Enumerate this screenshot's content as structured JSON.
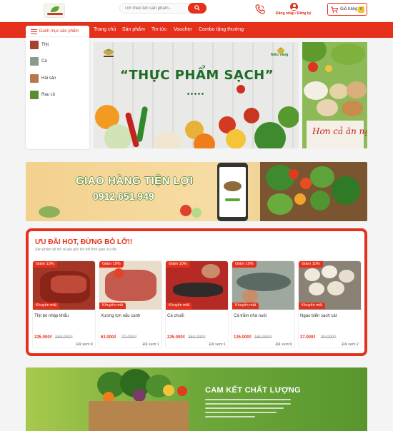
{
  "colors": {
    "brand_red": "#e5301c",
    "brand_green": "#1e6b26",
    "badge_yellow": "#f5c331"
  },
  "header": {
    "search_placeholder": "Tìm theo tên sản phẩm...",
    "login_label": "Đăng nhập / Đăng ký",
    "cart_label": "Giỏ hàng",
    "cart_count": "0"
  },
  "nav": {
    "items": [
      "Trang chủ",
      "Sản phẩm",
      "Tin tức",
      "Voucher",
      "Combo tặng thưởng"
    ]
  },
  "sidebar": {
    "title": "Danh mục sản phẩm",
    "items": [
      {
        "label": "Thịt",
        "color": "#a8402f"
      },
      {
        "label": "Cá",
        "color": "#8c9a8a"
      },
      {
        "label": "Hải sản",
        "color": "#b8774a"
      },
      {
        "label": "Rau củ",
        "color": "#5b8b33"
      }
    ]
  },
  "hero": {
    "title": "“THỰC PHẨM SẠCH”",
    "brand": "Niêu Vàng"
  },
  "side_banner": {
    "book_title": "Hơn cả ăn ngon"
  },
  "delivery": {
    "title": "GIAO HÀNG TIỆN LỢI",
    "phone": "0912.651.949"
  },
  "deals": {
    "title": "ƯU ĐÃI HOT, ĐỪNG BỎ LỠ!!",
    "subtitle": "Sản phẩm sẽ trở về giá gốc khi hết thời gian ưu đãi",
    "products": [
      {
        "name": "Thịt bò nhập khẩu",
        "discount": "Giảm 10%",
        "promo": "Khuyến mãi",
        "price": "225.000₫",
        "old_price": "250.000₫",
        "sold": "Đã xem:0",
        "img": "#a33626"
      },
      {
        "name": "Xương lợn nấu canh",
        "discount": "Giảm 10%",
        "promo": "Khuyến mãi",
        "price": "63.000₫",
        "old_price": "70.000₫",
        "sold": "Đã xem:1",
        "img": "#c45a4d"
      },
      {
        "name": "Cá chuối",
        "discount": "Giảm 10%",
        "promo": "Khuyến mãi",
        "price": "225.000₫",
        "old_price": "250.000₫",
        "sold": "Đã xem:1",
        "img": "#b52a24"
      },
      {
        "name": "Cá trắm nhà nuôi",
        "discount": "Giảm 10%",
        "promo": "Khuyến mãi",
        "price": "135.000₫",
        "old_price": "150.000₫",
        "sold": "Đã xem:0",
        "img": "#6e8079"
      },
      {
        "name": "Ngao biển sạch cát",
        "discount": "Giảm 10%",
        "promo": "Khuyến mãi",
        "price": "27.000₫",
        "old_price": "30.000₫",
        "sold": "Đã xem:2",
        "img": "#8a8375"
      }
    ]
  },
  "quality": {
    "title": "CAM KẾT CHẤT LƯỢNG"
  }
}
